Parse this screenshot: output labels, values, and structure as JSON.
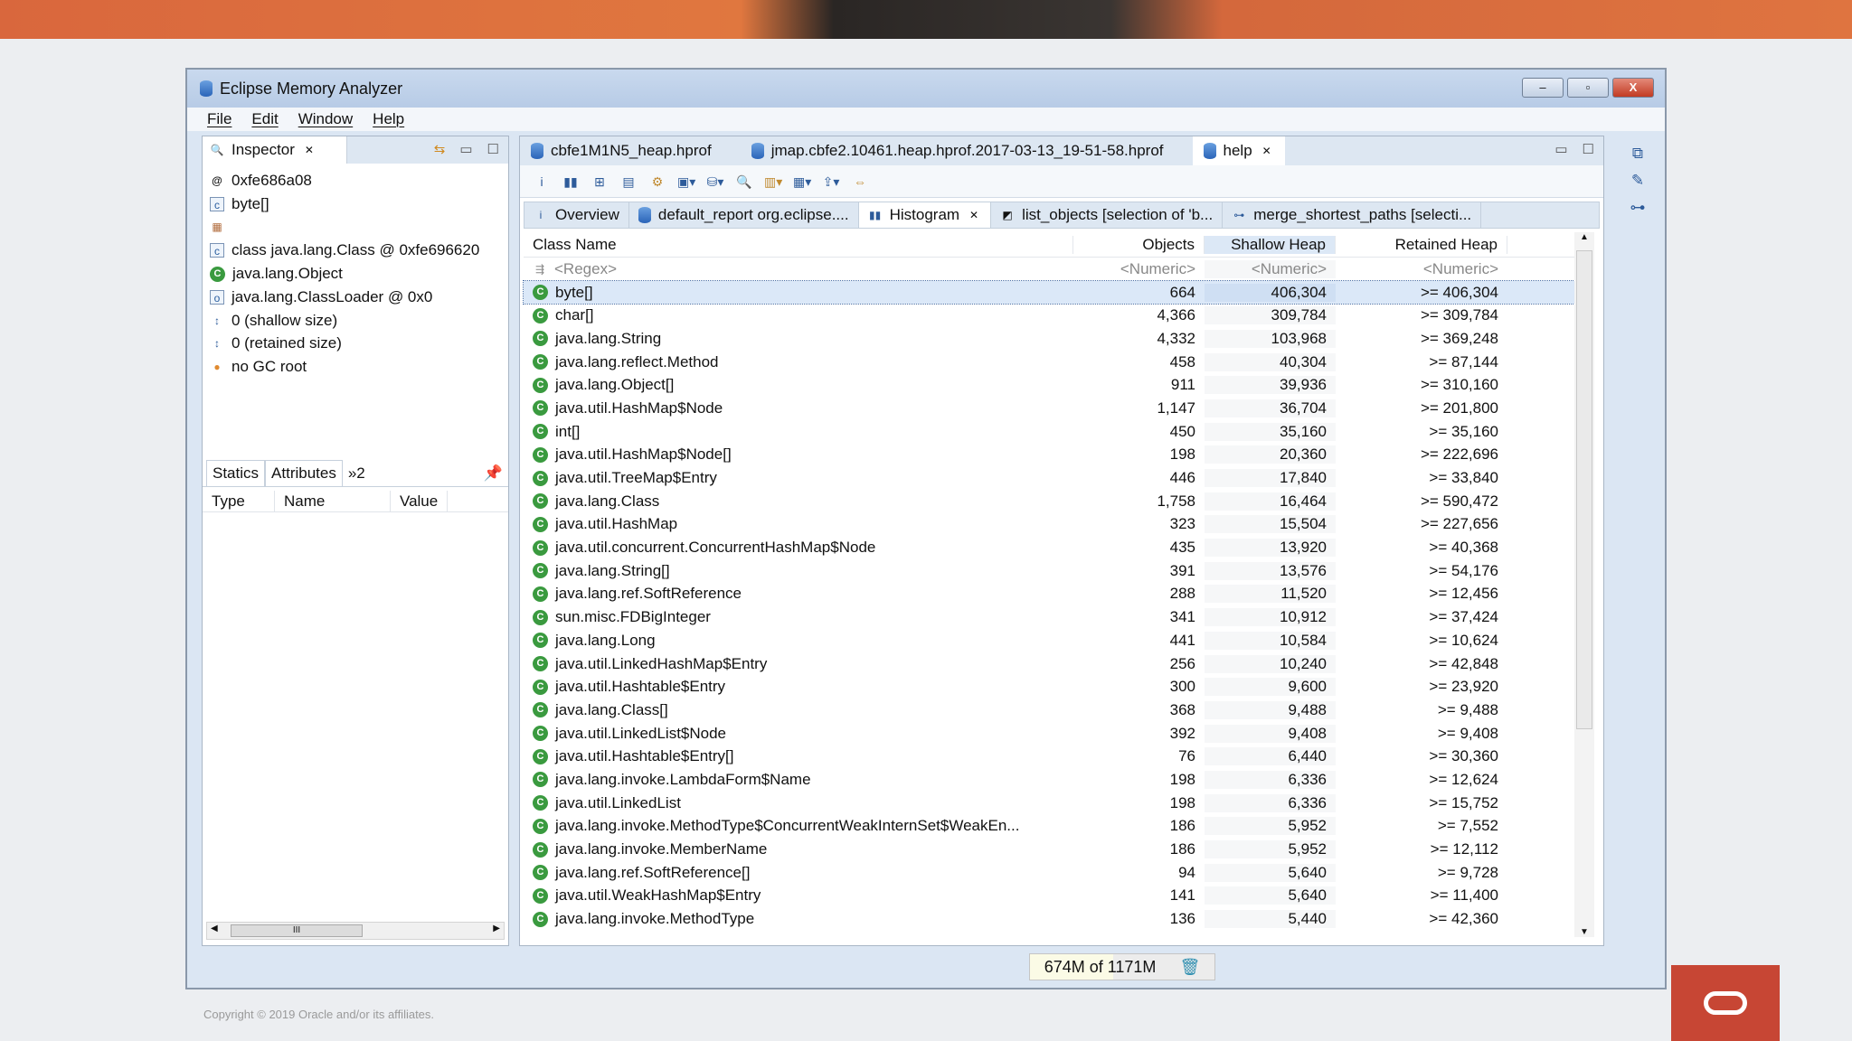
{
  "window": {
    "title": "Eclipse Memory Analyzer",
    "min": "–",
    "max": "▫",
    "close": "X"
  },
  "menu": [
    "File",
    "Edit",
    "Window",
    "Help"
  ],
  "inspector": {
    "tab": "Inspector",
    "items": [
      {
        "icon": "at-icon",
        "text": "0xfe686a08"
      },
      {
        "icon": "class-file-icon",
        "text": "byte[]"
      },
      {
        "icon": "grid-icon",
        "text": ""
      },
      {
        "icon": "class-file-icon",
        "text": "class java.lang.Class @ 0xfe696620"
      },
      {
        "icon": "superclass-icon",
        "text": "java.lang.Object"
      },
      {
        "icon": "classloader-icon",
        "text": "java.lang.ClassLoader @ 0x0"
      },
      {
        "icon": "size-icon",
        "text": "0 (shallow size)"
      },
      {
        "icon": "size-icon",
        "text": "0 (retained size)"
      },
      {
        "icon": "gc-root-icon",
        "text": "no GC root"
      }
    ],
    "subtabs": [
      "Statics",
      "Attributes",
      "»2"
    ],
    "columns": [
      "Type",
      "Name",
      "Value"
    ],
    "scroll_thumb": "III"
  },
  "editor_tabs": [
    "cbfe1M1N5_heap.hprof",
    "jmap.cbfe2.10461.heap.hprof.2017-03-13_19-51-58.hprof",
    "help"
  ],
  "query_tabs": [
    "Overview",
    "default_report  org.eclipse....",
    "Histogram",
    "list_objects [selection of 'b...",
    "merge_shortest_paths [selecti..."
  ],
  "table": {
    "columns": [
      "Class Name",
      "Objects",
      "Shallow Heap",
      "Retained Heap"
    ],
    "filters": [
      "<Regex>",
      "<Numeric>",
      "<Numeric>",
      "<Numeric>"
    ],
    "rows": [
      [
        "byte[]",
        "664",
        "406,304",
        ">= 406,304"
      ],
      [
        "char[]",
        "4,366",
        "309,784",
        ">= 309,784"
      ],
      [
        "java.lang.String",
        "4,332",
        "103,968",
        ">= 369,248"
      ],
      [
        "java.lang.reflect.Method",
        "458",
        "40,304",
        ">= 87,144"
      ],
      [
        "java.lang.Object[]",
        "911",
        "39,936",
        ">= 310,160"
      ],
      [
        "java.util.HashMap$Node",
        "1,147",
        "36,704",
        ">= 201,800"
      ],
      [
        "int[]",
        "450",
        "35,160",
        ">= 35,160"
      ],
      [
        "java.util.HashMap$Node[]",
        "198",
        "20,360",
        ">= 222,696"
      ],
      [
        "java.util.TreeMap$Entry",
        "446",
        "17,840",
        ">= 33,840"
      ],
      [
        "java.lang.Class",
        "1,758",
        "16,464",
        ">= 590,472"
      ],
      [
        "java.util.HashMap",
        "323",
        "15,504",
        ">= 227,656"
      ],
      [
        "java.util.concurrent.ConcurrentHashMap$Node",
        "435",
        "13,920",
        ">= 40,368"
      ],
      [
        "java.lang.String[]",
        "391",
        "13,576",
        ">= 54,176"
      ],
      [
        "java.lang.ref.SoftReference",
        "288",
        "11,520",
        ">= 12,456"
      ],
      [
        "sun.misc.FDBigInteger",
        "341",
        "10,912",
        ">= 37,424"
      ],
      [
        "java.lang.Long",
        "441",
        "10,584",
        ">= 10,624"
      ],
      [
        "java.util.LinkedHashMap$Entry",
        "256",
        "10,240",
        ">= 42,848"
      ],
      [
        "java.util.Hashtable$Entry",
        "300",
        "9,600",
        ">= 23,920"
      ],
      [
        "java.lang.Class[]",
        "368",
        "9,488",
        ">= 9,488"
      ],
      [
        "java.util.LinkedList$Node",
        "392",
        "9,408",
        ">= 9,408"
      ],
      [
        "java.util.Hashtable$Entry[]",
        "76",
        "6,440",
        ">= 30,360"
      ],
      [
        "java.lang.invoke.LambdaForm$Name",
        "198",
        "6,336",
        ">= 12,624"
      ],
      [
        "java.util.LinkedList",
        "198",
        "6,336",
        ">= 15,752"
      ],
      [
        "java.lang.invoke.MethodType$ConcurrentWeakInternSet$WeakEn...",
        "186",
        "5,952",
        ">= 7,552"
      ],
      [
        "java.lang.invoke.MemberName",
        "186",
        "5,952",
        ">= 12,112"
      ],
      [
        "java.lang.ref.SoftReference[]",
        "94",
        "5,640",
        ">= 9,728"
      ],
      [
        "java.util.WeakHashMap$Entry",
        "141",
        "5,640",
        ">= 11,400"
      ],
      [
        "java.lang.invoke.MethodType",
        "136",
        "5,440",
        ">= 42,360"
      ]
    ]
  },
  "status": {
    "heap": "674M of 1171M"
  },
  "footer": {
    "copyright": "Copyright © 2019 Oracle and/or its affiliates."
  },
  "colors": {
    "accent": "#c74634",
    "class_icon": "#3a9a3f"
  }
}
